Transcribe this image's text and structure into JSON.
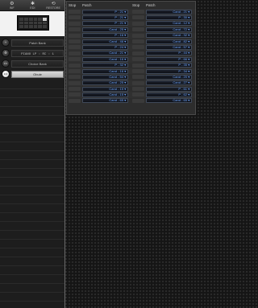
{
  "toolbar": {
    "buttons": [
      {
        "icon": "⚙",
        "label": "INF"
      },
      {
        "icon": "✱",
        "label": "EDI"
      },
      {
        "icon": "⟲",
        "label": "RESTORE"
      }
    ]
  },
  "sidebar": {
    "patch_bank": "Patch Bank",
    "piano_field": "PIANO LP  : RC  :   1",
    "choice_bank": "Choice Bank",
    "obuie": "Obuie",
    "button_labels": [
      "+",
      "⚙",
      "•••",
      "•••"
    ]
  },
  "patch_panel": {
    "headers": {
      "stop": "Stop",
      "patch": "Patch"
    },
    "left_column": [
      "P - 21",
      "P - 21",
      "P - 21",
      "Cand - 25",
      "P - 16",
      "Cand - 46",
      "P - 24",
      "Cand - 21",
      "Cand - 16",
      "P - 32",
      "Cand - 16",
      "Cand - 54",
      "Cand - 25",
      "Cand - 15",
      "Cand - 15",
      "Cand - 65"
    ],
    "right_column": [
      "Cand - 21",
      "P - 30",
      "Cand - 12",
      "Cand - 72",
      "Cand - 32",
      "Cand - 82",
      "Cand - 57",
      "P - 44",
      "P - 66",
      "P - 35",
      "P - 34",
      "Cand - 20",
      "Cand - 27",
      "P - 61",
      "P - 62",
      "Cand - 65"
    ]
  }
}
